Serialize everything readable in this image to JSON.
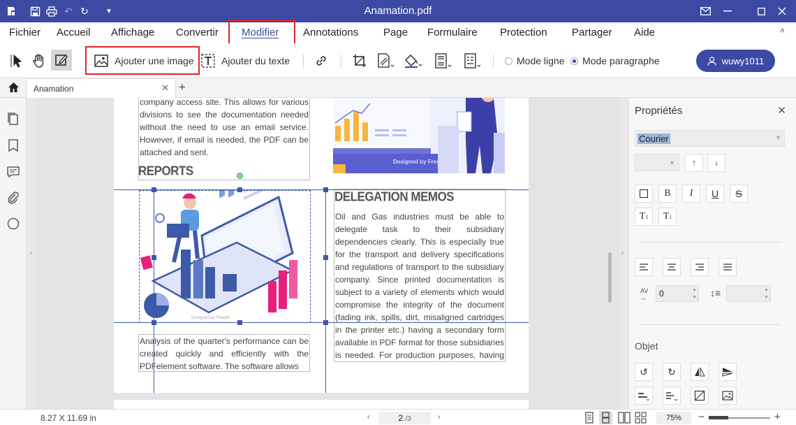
{
  "window": {
    "title": "Anamation.pdf",
    "controls": [
      "mail-icon",
      "minimize-icon",
      "maximize-icon",
      "close-icon"
    ]
  },
  "menu": {
    "items": [
      "Fichier",
      "Accueil",
      "Affichage",
      "Convertir",
      "Modifier",
      "Annotations",
      "Page",
      "Formulaire",
      "Protection",
      "Partager",
      "Aide"
    ],
    "active": "Modifier"
  },
  "toolbar": {
    "add_image": "Ajouter une image",
    "add_text": "Ajouter du texte",
    "mode_line": "Mode ligne",
    "mode_paragraph": "Mode paragraphe",
    "selected_mode": "Mode paragraphe",
    "user": "wuwy1011"
  },
  "tabs": {
    "doc_tab": "Anamation",
    "new_tab": "+"
  },
  "document": {
    "left_intro": "company access site. This allows for various divisions to see the documentation needed without the need to use an email service. However, if email is needed, the PDF can be attached and sent.",
    "reports_heading": "REPORTS",
    "reports_text": "Analysis of the quarter's performance can be created quickly and efficiently with the PDFelement software. The software allows",
    "memos_heading": "DELEGATION MEMOS",
    "memos_text": "Oil and Gas industries must be able to delegate task to their subsidiary dependencies clearly. This is especially true for the transport and delivery specifications and regulations of transport to the subsidiary company. Since printed documentation is subject to a variety of elements which would compromise the integrity of the document (fading ink, spills, dirt, misaligned cartridges in the printer etc.) having a secondary form available in PDF format for those subsidiaries is needed. For production purposes, having this PDF on hand",
    "image_credit_top": "Designed by Freepik",
    "image_credit_small": "Designed by Freepik"
  },
  "properties": {
    "title": "Propriétés",
    "font": "Courier",
    "font_size": "",
    "char_spacing": "0",
    "line_spacing": "",
    "object_section": "Objet"
  },
  "status": {
    "page_size": "8.27 X 11.69 in",
    "current_page": "2",
    "total_pages": "/3",
    "zoom": "75%"
  },
  "colors": {
    "brand": "#3c4aa3",
    "highlight_box": "#e0242a",
    "selection": "#3c5aa8"
  }
}
